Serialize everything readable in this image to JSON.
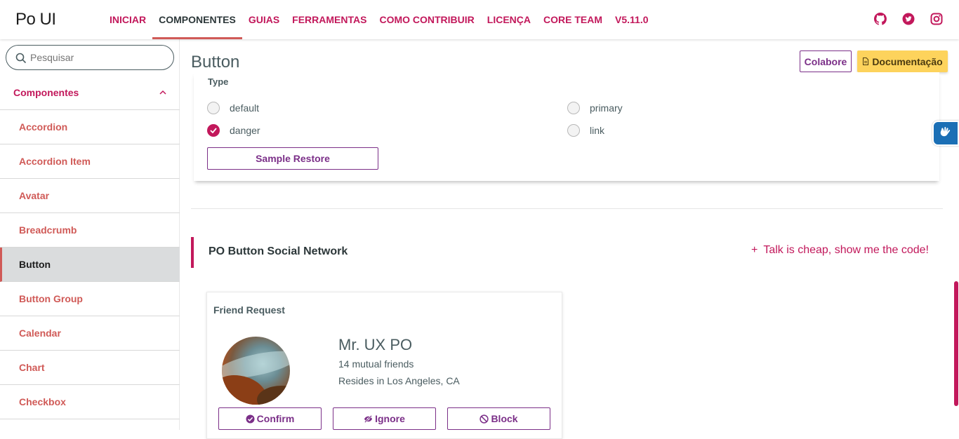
{
  "app": {
    "logo": "Po UI"
  },
  "nav": {
    "items": [
      {
        "label": "INICIAR",
        "active": false
      },
      {
        "label": "COMPONENTES",
        "active": true
      },
      {
        "label": "GUIAS",
        "active": false
      },
      {
        "label": "FERRAMENTAS",
        "active": false
      },
      {
        "label": "COMO CONTRIBUIR",
        "active": false
      },
      {
        "label": "LICENÇA",
        "active": false
      },
      {
        "label": "CORE TEAM",
        "active": false
      },
      {
        "label": "V5.11.0",
        "active": false
      }
    ],
    "social_icons": [
      "github-icon",
      "twitter-icon",
      "instagram-icon"
    ]
  },
  "sidebar": {
    "search_placeholder": "Pesquisar",
    "group_label": "Componentes",
    "items": [
      {
        "label": "Accordion",
        "active": false
      },
      {
        "label": "Accordion Item",
        "active": false
      },
      {
        "label": "Avatar",
        "active": false
      },
      {
        "label": "Breadcrumb",
        "active": false
      },
      {
        "label": "Button",
        "active": true
      },
      {
        "label": "Button Group",
        "active": false
      },
      {
        "label": "Calendar",
        "active": false
      },
      {
        "label": "Chart",
        "active": false
      },
      {
        "label": "Checkbox",
        "active": false
      }
    ]
  },
  "page": {
    "title": "Button",
    "colabore_label": "Colabore",
    "doc_label": "Documentação"
  },
  "sample": {
    "type_label": "Type",
    "radios": [
      {
        "label": "default",
        "checked": false
      },
      {
        "label": "primary",
        "checked": false
      },
      {
        "label": "danger",
        "checked": true
      },
      {
        "label": "link",
        "checked": false
      }
    ],
    "restore_label": "Sample Restore"
  },
  "section": {
    "title": "PO Button Social Network",
    "code_link": "Talk is cheap, show me the code!",
    "code_link_icon": "+"
  },
  "friend_card": {
    "title": "Friend Request",
    "name": "Mr. UX PO",
    "mutual": "14 mutual friends",
    "location": "Resides in Los Angeles, CA",
    "confirm_label": "Confirm",
    "ignore_label": "Ignore",
    "block_label": "Block"
  },
  "colors": {
    "accent": "#c2185b",
    "primary": "#7b2f88",
    "nav_underline": "#d05a57",
    "doc_button": "#fdd35c"
  }
}
